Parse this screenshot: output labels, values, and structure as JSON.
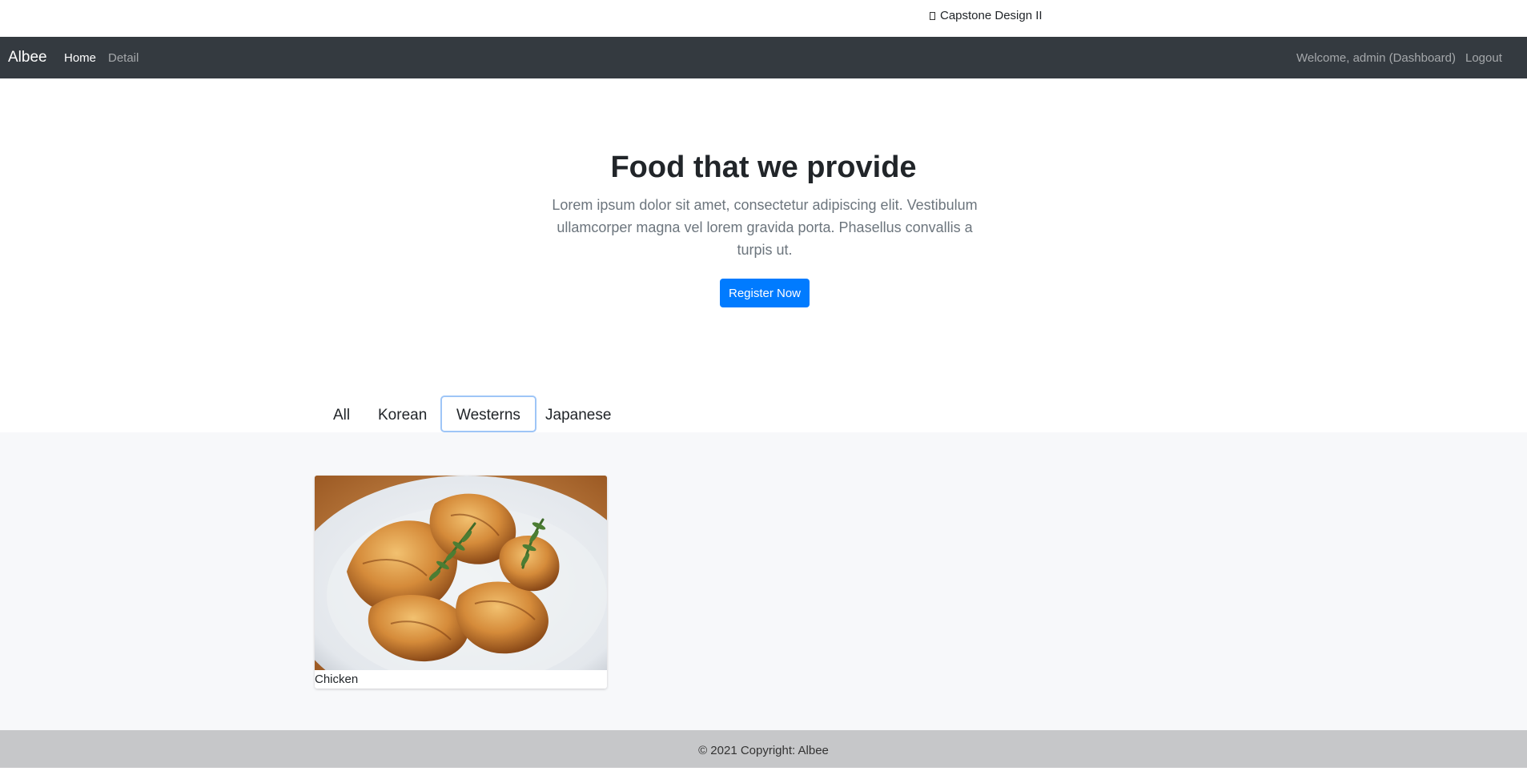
{
  "window": {
    "tab_title": "Capstone Design II"
  },
  "navbar": {
    "brand": "Albee",
    "links": [
      {
        "label": "Home",
        "active": true
      },
      {
        "label": "Detail",
        "active": false
      }
    ],
    "welcome": "Welcome, admin (Dashboard)",
    "logout": "Logout"
  },
  "hero": {
    "title": "Food that we provide",
    "lead": "Lorem ipsum dolor sit amet, consectetur adipiscing elit. Vestibulum ullamcorper magna vel lorem gravida porta. Phasellus convallis a turpis ut.",
    "button": "Register Now"
  },
  "filters": {
    "items": [
      "All",
      "Korean",
      "Westerns",
      "Japanese"
    ],
    "selected": "Westerns"
  },
  "gallery": {
    "items": [
      {
        "caption": "Chicken",
        "image": "plate-of-roasted-chicken-wings"
      }
    ]
  },
  "footer": {
    "copyright": "© 2021 Copyright: Albee"
  },
  "colors": {
    "navbar_bg": "#343a40",
    "primary": "#007bff",
    "gallery_bg": "#f7f8fa",
    "footer_bg": "#c6c7c9",
    "selected_filter_border": "#9ec5f7"
  }
}
